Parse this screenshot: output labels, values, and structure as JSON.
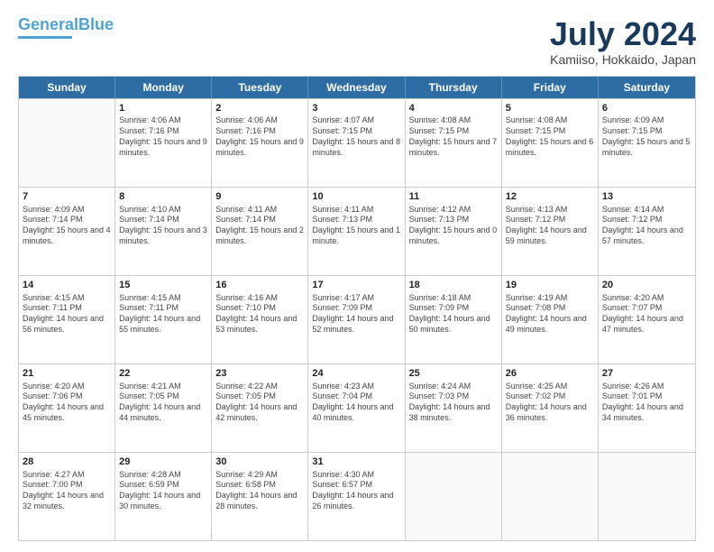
{
  "header": {
    "logo_line1": "General",
    "logo_line2": "Blue",
    "title": "July 2024",
    "location": "Kamiiso, Hokkaido, Japan"
  },
  "days_of_week": [
    "Sunday",
    "Monday",
    "Tuesday",
    "Wednesday",
    "Thursday",
    "Friday",
    "Saturday"
  ],
  "weeks": [
    [
      {
        "day": "",
        "sunrise": "",
        "sunset": "",
        "daylight": ""
      },
      {
        "day": "1",
        "sunrise": "Sunrise: 4:06 AM",
        "sunset": "Sunset: 7:16 PM",
        "daylight": "Daylight: 15 hours and 9 minutes."
      },
      {
        "day": "2",
        "sunrise": "Sunrise: 4:06 AM",
        "sunset": "Sunset: 7:16 PM",
        "daylight": "Daylight: 15 hours and 9 minutes."
      },
      {
        "day": "3",
        "sunrise": "Sunrise: 4:07 AM",
        "sunset": "Sunset: 7:15 PM",
        "daylight": "Daylight: 15 hours and 8 minutes."
      },
      {
        "day": "4",
        "sunrise": "Sunrise: 4:08 AM",
        "sunset": "Sunset: 7:15 PM",
        "daylight": "Daylight: 15 hours and 7 minutes."
      },
      {
        "day": "5",
        "sunrise": "Sunrise: 4:08 AM",
        "sunset": "Sunset: 7:15 PM",
        "daylight": "Daylight: 15 hours and 6 minutes."
      },
      {
        "day": "6",
        "sunrise": "Sunrise: 4:09 AM",
        "sunset": "Sunset: 7:15 PM",
        "daylight": "Daylight: 15 hours and 5 minutes."
      }
    ],
    [
      {
        "day": "7",
        "sunrise": "Sunrise: 4:09 AM",
        "sunset": "Sunset: 7:14 PM",
        "daylight": "Daylight: 15 hours and 4 minutes."
      },
      {
        "day": "8",
        "sunrise": "Sunrise: 4:10 AM",
        "sunset": "Sunset: 7:14 PM",
        "daylight": "Daylight: 15 hours and 3 minutes."
      },
      {
        "day": "9",
        "sunrise": "Sunrise: 4:11 AM",
        "sunset": "Sunset: 7:14 PM",
        "daylight": "Daylight: 15 hours and 2 minutes."
      },
      {
        "day": "10",
        "sunrise": "Sunrise: 4:11 AM",
        "sunset": "Sunset: 7:13 PM",
        "daylight": "Daylight: 15 hours and 1 minute."
      },
      {
        "day": "11",
        "sunrise": "Sunrise: 4:12 AM",
        "sunset": "Sunset: 7:13 PM",
        "daylight": "Daylight: 15 hours and 0 minutes."
      },
      {
        "day": "12",
        "sunrise": "Sunrise: 4:13 AM",
        "sunset": "Sunset: 7:12 PM",
        "daylight": "Daylight: 14 hours and 59 minutes."
      },
      {
        "day": "13",
        "sunrise": "Sunrise: 4:14 AM",
        "sunset": "Sunset: 7:12 PM",
        "daylight": "Daylight: 14 hours and 57 minutes."
      }
    ],
    [
      {
        "day": "14",
        "sunrise": "Sunrise: 4:15 AM",
        "sunset": "Sunset: 7:11 PM",
        "daylight": "Daylight: 14 hours and 56 minutes."
      },
      {
        "day": "15",
        "sunrise": "Sunrise: 4:15 AM",
        "sunset": "Sunset: 7:11 PM",
        "daylight": "Daylight: 14 hours and 55 minutes."
      },
      {
        "day": "16",
        "sunrise": "Sunrise: 4:16 AM",
        "sunset": "Sunset: 7:10 PM",
        "daylight": "Daylight: 14 hours and 53 minutes."
      },
      {
        "day": "17",
        "sunrise": "Sunrise: 4:17 AM",
        "sunset": "Sunset: 7:09 PM",
        "daylight": "Daylight: 14 hours and 52 minutes."
      },
      {
        "day": "18",
        "sunrise": "Sunrise: 4:18 AM",
        "sunset": "Sunset: 7:09 PM",
        "daylight": "Daylight: 14 hours and 50 minutes."
      },
      {
        "day": "19",
        "sunrise": "Sunrise: 4:19 AM",
        "sunset": "Sunset: 7:08 PM",
        "daylight": "Daylight: 14 hours and 49 minutes."
      },
      {
        "day": "20",
        "sunrise": "Sunrise: 4:20 AM",
        "sunset": "Sunset: 7:07 PM",
        "daylight": "Daylight: 14 hours and 47 minutes."
      }
    ],
    [
      {
        "day": "21",
        "sunrise": "Sunrise: 4:20 AM",
        "sunset": "Sunset: 7:06 PM",
        "daylight": "Daylight: 14 hours and 45 minutes."
      },
      {
        "day": "22",
        "sunrise": "Sunrise: 4:21 AM",
        "sunset": "Sunset: 7:05 PM",
        "daylight": "Daylight: 14 hours and 44 minutes."
      },
      {
        "day": "23",
        "sunrise": "Sunrise: 4:22 AM",
        "sunset": "Sunset: 7:05 PM",
        "daylight": "Daylight: 14 hours and 42 minutes."
      },
      {
        "day": "24",
        "sunrise": "Sunrise: 4:23 AM",
        "sunset": "Sunset: 7:04 PM",
        "daylight": "Daylight: 14 hours and 40 minutes."
      },
      {
        "day": "25",
        "sunrise": "Sunrise: 4:24 AM",
        "sunset": "Sunset: 7:03 PM",
        "daylight": "Daylight: 14 hours and 38 minutes."
      },
      {
        "day": "26",
        "sunrise": "Sunrise: 4:25 AM",
        "sunset": "Sunset: 7:02 PM",
        "daylight": "Daylight: 14 hours and 36 minutes."
      },
      {
        "day": "27",
        "sunrise": "Sunrise: 4:26 AM",
        "sunset": "Sunset: 7:01 PM",
        "daylight": "Daylight: 14 hours and 34 minutes."
      }
    ],
    [
      {
        "day": "28",
        "sunrise": "Sunrise: 4:27 AM",
        "sunset": "Sunset: 7:00 PM",
        "daylight": "Daylight: 14 hours and 32 minutes."
      },
      {
        "day": "29",
        "sunrise": "Sunrise: 4:28 AM",
        "sunset": "Sunset: 6:59 PM",
        "daylight": "Daylight: 14 hours and 30 minutes."
      },
      {
        "day": "30",
        "sunrise": "Sunrise: 4:29 AM",
        "sunset": "Sunset: 6:58 PM",
        "daylight": "Daylight: 14 hours and 28 minutes."
      },
      {
        "day": "31",
        "sunrise": "Sunrise: 4:30 AM",
        "sunset": "Sunset: 6:57 PM",
        "daylight": "Daylight: 14 hours and 26 minutes."
      },
      {
        "day": "",
        "sunrise": "",
        "sunset": "",
        "daylight": ""
      },
      {
        "day": "",
        "sunrise": "",
        "sunset": "",
        "daylight": ""
      },
      {
        "day": "",
        "sunrise": "",
        "sunset": "",
        "daylight": ""
      }
    ]
  ]
}
